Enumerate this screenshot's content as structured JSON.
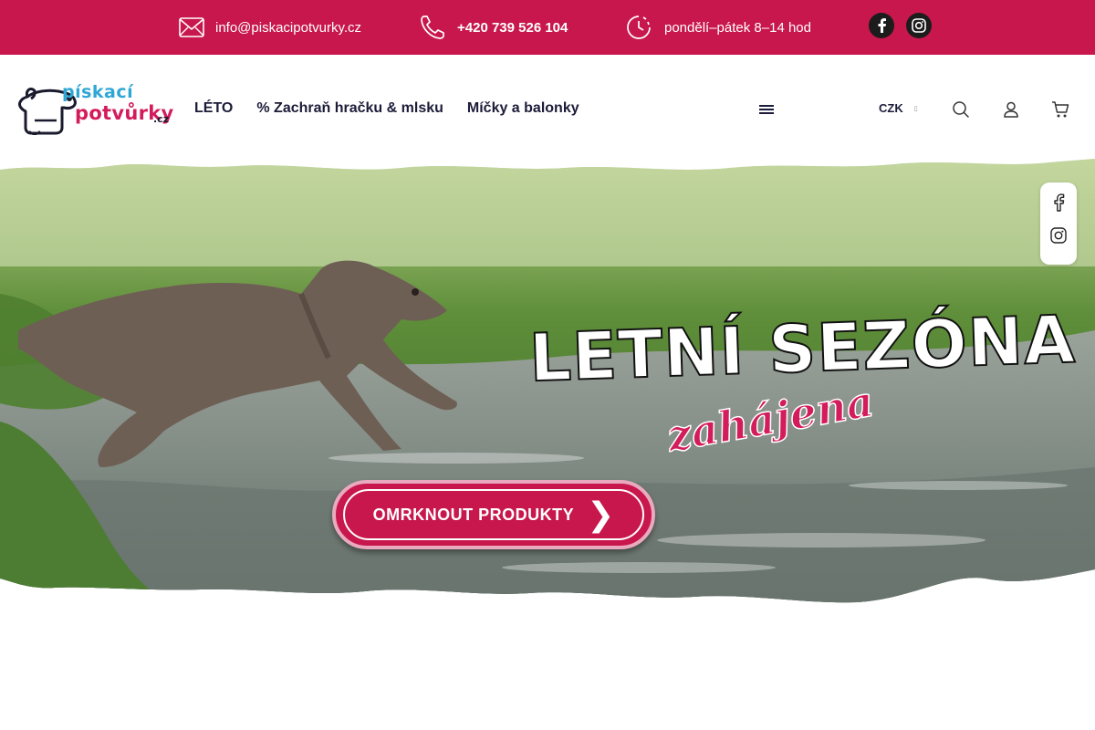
{
  "topbar": {
    "email": "info@piskacipotvurky.cz",
    "phone": "+420 739 526 104",
    "hours": "pondělí–pátek 8–14 hod",
    "email_icon": "envelope-icon",
    "phone_icon": "phone-icon",
    "hours_icon": "clock-icon",
    "social": [
      "facebook-icon",
      "instagram-icon"
    ],
    "bg_color": "#c8174d"
  },
  "header": {
    "logo": {
      "line1": "pískací",
      "line2": "potvůrky",
      "suffix": ".cz"
    },
    "nav": [
      {
        "label": "LÉTO"
      },
      {
        "label": "% Zachraň hračku & mlsku"
      },
      {
        "label": "Míčky a balonky"
      }
    ],
    "currency": "CZK",
    "currency_arrow": "▯",
    "icons": [
      "menu-icon",
      "search-icon",
      "user-icon",
      "cart-icon"
    ]
  },
  "hero": {
    "title": "LETNÍ SEZÓNA",
    "subtitle": "zahájena",
    "button_label": "OMRKNOUT PRODUKTY",
    "button_chevron": "❯",
    "accent_color": "#d31c5b"
  },
  "side_social": [
    "facebook-outline-icon",
    "instagram-outline-icon"
  ]
}
